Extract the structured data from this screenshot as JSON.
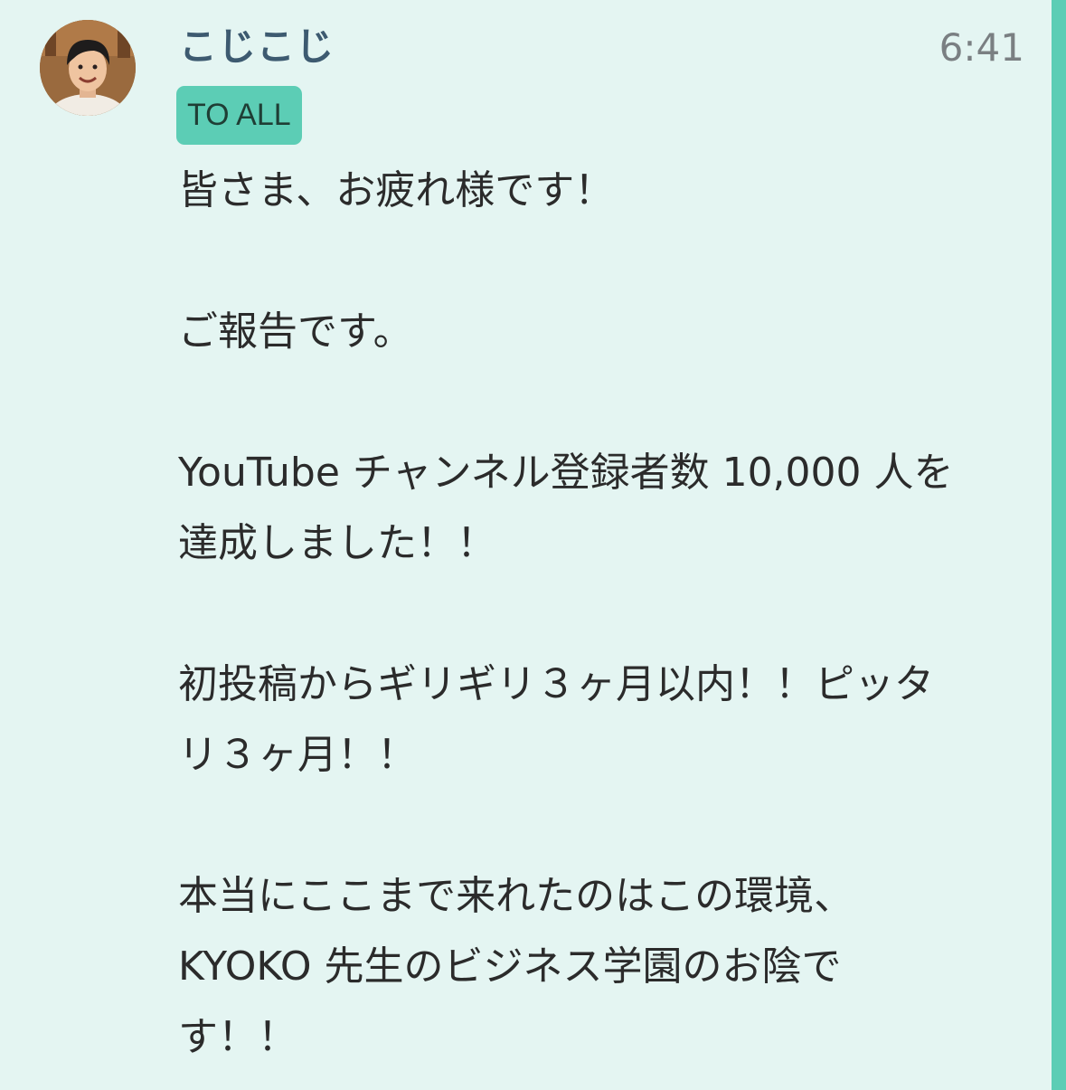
{
  "message": {
    "sender": "こじこじ",
    "time": "6:41",
    "badge": "TO ALL",
    "paragraphs": [
      "皆さま、お疲れ様です！",
      "ご報告です。",
      "YouTube チャンネル登録者数 10,000 人を\n達成しました！！",
      "初投稿からギリギリ３ヶ月以内！！ピッタ\nリ３ヶ月！！",
      "本当にここまで来れたのはこの環境、\nKYOKO 先生のビジネス学園のお陰で\nす！！"
    ]
  },
  "colors": {
    "background": "#e4f5f2",
    "accent": "#5ccdb5",
    "sender": "#3d5a70",
    "time": "#7a7f82",
    "text": "#2b2b2b"
  }
}
